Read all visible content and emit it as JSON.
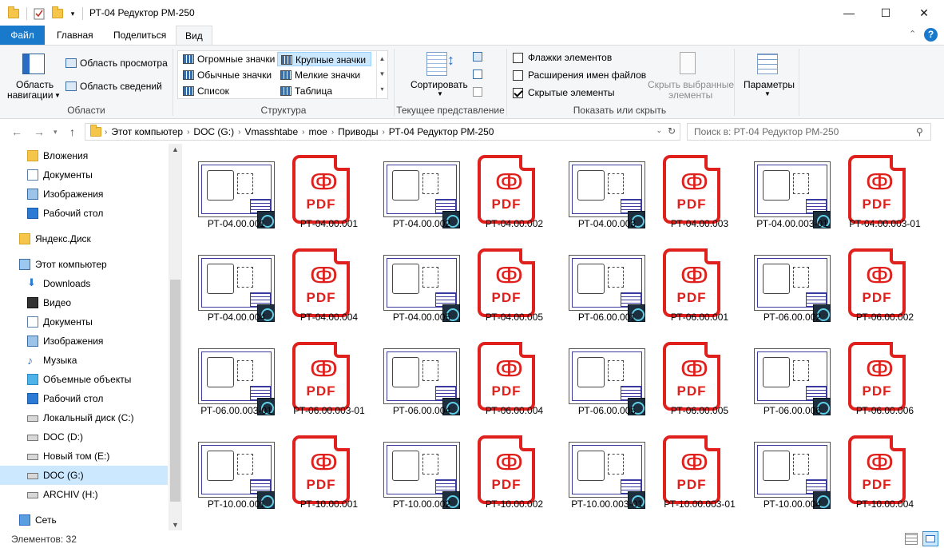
{
  "window": {
    "title": "РТ-04 Редуктор РМ-250",
    "minimize_glyph": "—",
    "maximize_glyph": "☐",
    "close_glyph": "✕"
  },
  "tabs": [
    {
      "label": "Файл"
    },
    {
      "label": "Главная"
    },
    {
      "label": "Поделиться"
    },
    {
      "label": "Вид"
    }
  ],
  "ribbon": {
    "panes": {
      "nav_pane_line1": "Область",
      "nav_pane_line2": "навигации",
      "preview": "Область просмотра",
      "details": "Область сведений",
      "group": "Области"
    },
    "layout": {
      "items": [
        "Огромные значки",
        "Крупные значки",
        "Обычные значки",
        "Мелкие значки",
        "Список",
        "Таблица"
      ],
      "selected": "Крупные значки",
      "group": "Структура"
    },
    "current_view": {
      "sort": "Сортировать",
      "group": "Текущее представление"
    },
    "show_hide": {
      "checkboxes": [
        {
          "label": "Флажки элементов",
          "checked": false
        },
        {
          "label": "Расширения имен файлов",
          "checked": false
        },
        {
          "label": "Скрытые элементы",
          "checked": true
        }
      ],
      "hide_selected_line1": "Скрыть выбранные",
      "hide_selected_line2": "элементы",
      "group": "Показать или скрыть"
    },
    "options": {
      "label": "Параметры"
    }
  },
  "address": {
    "crumbs": [
      "Этот компьютер",
      "DOC (G:)",
      "Vmasshtabe",
      "moe",
      "Приводы",
      "РТ-04 Редуктор РМ-250"
    ],
    "search_placeholder": "Поиск в: РТ-04 Редуктор РМ-250"
  },
  "sidebar": {
    "items": [
      {
        "label": "Вложения",
        "icon": "folder-icon",
        "indent": 1
      },
      {
        "label": "Документы",
        "icon": "documents-icon",
        "indent": 1
      },
      {
        "label": "Изображения",
        "icon": "pictures-icon",
        "indent": 1
      },
      {
        "label": "Рабочий стол",
        "icon": "desktop-icon",
        "indent": 1
      },
      {
        "label": "Яндекс.Диск",
        "icon": "yandex-disk-icon",
        "indent": 0
      },
      {
        "label": "Этот компьютер",
        "icon": "computer-icon",
        "indent": 0
      },
      {
        "label": "Downloads",
        "icon": "downloads-icon",
        "indent": 1
      },
      {
        "label": "Видео",
        "icon": "video-icon",
        "indent": 1
      },
      {
        "label": "Документы",
        "icon": "documents-icon",
        "indent": 1
      },
      {
        "label": "Изображения",
        "icon": "pictures-icon",
        "indent": 1
      },
      {
        "label": "Музыка",
        "icon": "music-icon",
        "indent": 1
      },
      {
        "label": "Объемные объекты",
        "icon": "3d-objects-icon",
        "indent": 1
      },
      {
        "label": "Рабочий стол",
        "icon": "desktop-icon",
        "indent": 1
      },
      {
        "label": "Локальный диск (C:)",
        "icon": "drive-icon",
        "indent": 1
      },
      {
        "label": "DOC (D:)",
        "icon": "drive-icon",
        "indent": 1
      },
      {
        "label": "Новый том (E:)",
        "icon": "drive-icon",
        "indent": 1
      },
      {
        "label": "DOC (G:)",
        "icon": "drive-icon",
        "indent": 1,
        "selected": true
      },
      {
        "label": "ARCHIV (H:)",
        "icon": "drive-icon",
        "indent": 1
      },
      {
        "label": "Сеть",
        "icon": "network-icon",
        "indent": 0
      }
    ]
  },
  "files": [
    {
      "name": "РТ-04.00.001",
      "type": "drawing"
    },
    {
      "name": "РТ-04.00.001",
      "type": "pdf"
    },
    {
      "name": "РТ-04.00.002",
      "type": "drawing"
    },
    {
      "name": "РТ-04.00.002",
      "type": "pdf"
    },
    {
      "name": "РТ-04.00.003",
      "type": "drawing"
    },
    {
      "name": "РТ-04.00.003",
      "type": "pdf"
    },
    {
      "name": "РТ-04.00.003-01",
      "type": "drawing"
    },
    {
      "name": "РТ-04.00.003-01",
      "type": "pdf"
    },
    {
      "name": "РТ-04.00.004",
      "type": "drawing"
    },
    {
      "name": "РТ-04.00.004",
      "type": "pdf"
    },
    {
      "name": "РТ-04.00.005",
      "type": "drawing"
    },
    {
      "name": "РТ-04.00.005",
      "type": "pdf"
    },
    {
      "name": "РТ-06.00.001",
      "type": "drawing"
    },
    {
      "name": "РТ-06.00.001",
      "type": "pdf"
    },
    {
      "name": "РТ-06.00.002",
      "type": "drawing"
    },
    {
      "name": "РТ-06.00.002",
      "type": "pdf"
    },
    {
      "name": "РТ-06.00.003-01",
      "type": "drawing"
    },
    {
      "name": "РТ-06.00.003-01",
      "type": "pdf"
    },
    {
      "name": "РТ-06.00.004",
      "type": "drawing"
    },
    {
      "name": "РТ-06.00.004",
      "type": "pdf"
    },
    {
      "name": "РТ-06.00.005",
      "type": "drawing"
    },
    {
      "name": "РТ-06.00.005",
      "type": "pdf"
    },
    {
      "name": "РТ-06.00.006",
      "type": "drawing"
    },
    {
      "name": "РТ-06.00.006",
      "type": "pdf"
    },
    {
      "name": "РТ-10.00.001",
      "type": "drawing"
    },
    {
      "name": "РТ-10.00.001",
      "type": "pdf"
    },
    {
      "name": "РТ-10.00.002",
      "type": "drawing"
    },
    {
      "name": "РТ-10.00.002",
      "type": "pdf"
    },
    {
      "name": "РТ-10.00.003-01",
      "type": "drawing"
    },
    {
      "name": "РТ-10.00.003-01",
      "type": "pdf"
    },
    {
      "name": "РТ-10.00.004",
      "type": "drawing"
    },
    {
      "name": "РТ-10.00.004",
      "type": "pdf"
    }
  ],
  "pdf_label": "PDF",
  "status": {
    "items_count": "Элементов: 32"
  },
  "colors": {
    "file_tab": "#1979ca",
    "pdf_red": "#e0201c",
    "selection": "#cce8ff"
  }
}
